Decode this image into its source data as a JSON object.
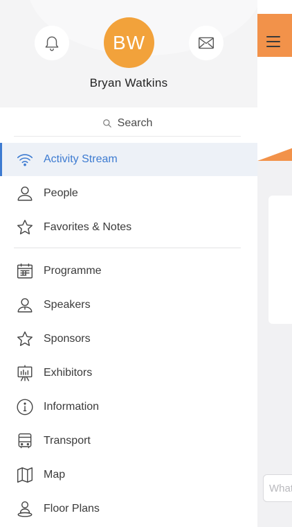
{
  "user": {
    "initials": "BW",
    "name": "Bryan Watkins",
    "avatar_color": "#f2a23b"
  },
  "search": {
    "label": "Search"
  },
  "menu": {
    "primary": [
      {
        "label": "Activity Stream",
        "icon": "wifi-icon",
        "active": true
      },
      {
        "label": "People",
        "icon": "person-icon",
        "active": false
      },
      {
        "label": "Favorites & Notes",
        "icon": "star-icon",
        "active": false
      }
    ],
    "secondary": [
      {
        "label": "Programme",
        "icon": "calendar-icon"
      },
      {
        "label": "Speakers",
        "icon": "speaker-icon"
      },
      {
        "label": "Sponsors",
        "icon": "star-icon"
      },
      {
        "label": "Exhibitors",
        "icon": "easel-icon"
      },
      {
        "label": "Information",
        "icon": "info-icon"
      },
      {
        "label": "Transport",
        "icon": "bus-icon"
      },
      {
        "label": "Map",
        "icon": "map-icon"
      },
      {
        "label": "Floor Plans",
        "icon": "floor-plans-icon"
      }
    ]
  },
  "background_app": {
    "accent_color": "#f2924a",
    "composer_placeholder": "What"
  },
  "colors": {
    "active_blue": "#3d7bd1",
    "active_bg": "#edf1f7"
  }
}
